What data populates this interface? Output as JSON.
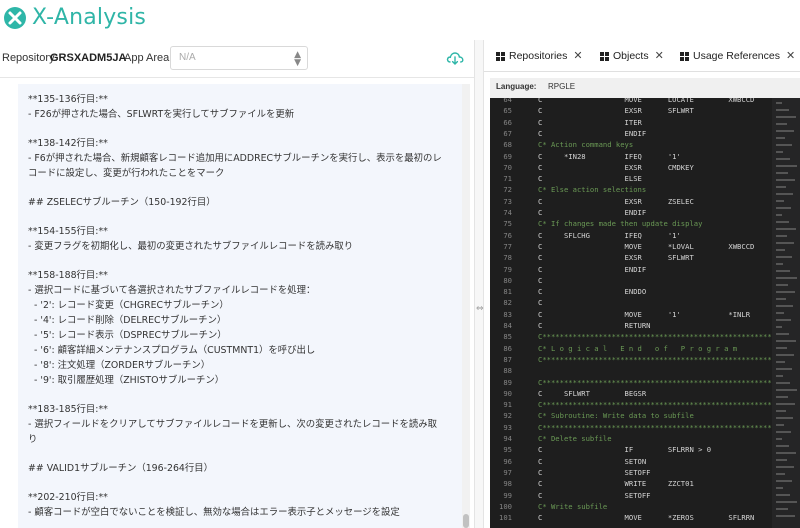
{
  "app": {
    "title": "X-Analysis"
  },
  "repo_bar": {
    "repository_label": "Repository:",
    "repository_value": "GRSXADM5JA",
    "app_area_label": "App Area:",
    "app_area_value": "N/A"
  },
  "doc": {
    "blocks": [
      {
        "type": "p",
        "text": "**135-136行目:**"
      },
      {
        "type": "p",
        "text": "- F26が押された場合、SFLWRTを実行してサブファイルを更新"
      },
      {
        "type": "gap"
      },
      {
        "type": "p",
        "text": "**138-142行目:**"
      },
      {
        "type": "p",
        "text": "- F6が押された場合、新規顧客レコード追加用にADDRECサブルーチンを実行し、表示を最初のレ"
      },
      {
        "type": "p",
        "text": "コードに設定し、変更が行われたことをマーク"
      },
      {
        "type": "gap"
      },
      {
        "type": "p",
        "text": "## ZSELECサブルーチン（150-192行目）"
      },
      {
        "type": "gap"
      },
      {
        "type": "p",
        "text": "**154-155行目:**"
      },
      {
        "type": "p",
        "text": "- 変更フラグを初期化し、最初の変更されたサブファイルレコードを読み取り"
      },
      {
        "type": "gap"
      },
      {
        "type": "p",
        "text": "**158-188行目:**"
      },
      {
        "type": "p",
        "text": "- 選択コードに基づいて各選択されたサブファイルレコードを処理："
      },
      {
        "type": "li",
        "text": "- '2': レコード変更（CHGRECサブルーチン）"
      },
      {
        "type": "li",
        "text": "- '4': レコード削除（DELRECサブルーチン）"
      },
      {
        "type": "li",
        "text": "- '5': レコード表示（DSPRECサブルーチン）"
      },
      {
        "type": "li",
        "text": "- '6': 顧客詳細メンテナンスプログラム（CUSTMNT1）を呼び出し"
      },
      {
        "type": "li",
        "text": "- '8': 注文処理（ZORDERサブルーチン）"
      },
      {
        "type": "li",
        "text": "- '9': 取引履歴処理（ZHISTOサブルーチン）"
      },
      {
        "type": "gap"
      },
      {
        "type": "p",
        "text": "**183-185行目:**"
      },
      {
        "type": "p",
        "text": "- 選択フィールドをクリアしてサブファイルレコードを更新し、次の変更されたレコードを読み取"
      },
      {
        "type": "p",
        "text": "り"
      },
      {
        "type": "gap"
      },
      {
        "type": "p",
        "text": "## VALID1サブルーチン（196-264行目）"
      },
      {
        "type": "gap"
      },
      {
        "type": "p",
        "text": "**202-210行目:**"
      },
      {
        "type": "p",
        "text": "- 顧客コードが空白でないことを検証し、無効な場合はエラー表示子とメッセージを設定"
      }
    ]
  },
  "tabs": [
    {
      "label": "Repositories"
    },
    {
      "label": "Objects"
    },
    {
      "label": "Usage References"
    }
  ],
  "language_bar": {
    "label": "Language:",
    "value": "RPGLE"
  },
  "code_lines": [
    {
      "n": "64",
      "t": "C                   MOVE      LOCATE        XWBCCD",
      "c": 0
    },
    {
      "n": "65",
      "t": "C                   EXSR      SFLWRT",
      "c": 0
    },
    {
      "n": "66",
      "t": "C                   ITER",
      "c": 0
    },
    {
      "n": "67",
      "t": "C                   ENDIF",
      "c": 0
    },
    {
      "n": "68",
      "t": "C* Action command keys",
      "c": 1
    },
    {
      "n": "69",
      "t": "C     *IN28         IFEQ      '1'",
      "c": 0
    },
    {
      "n": "70",
      "t": "C                   EXSR      CMDKEY",
      "c": 0
    },
    {
      "n": "71",
      "t": "C                   ELSE",
      "c": 0
    },
    {
      "n": "72",
      "t": "C* Else action selections",
      "c": 1
    },
    {
      "n": "73",
      "t": "C                   EXSR      ZSELEC",
      "c": 0
    },
    {
      "n": "74",
      "t": "C                   ENDIF",
      "c": 0
    },
    {
      "n": "75",
      "t": "C* If changes made then update display",
      "c": 1
    },
    {
      "n": "76",
      "t": "C     SFLCHG        IFEQ      '1'",
      "c": 0
    },
    {
      "n": "77",
      "t": "C                   MOVE      *LOVAL        XWBCCD",
      "c": 0
    },
    {
      "n": "78",
      "t": "C                   EXSR      SFLWRT",
      "c": 0
    },
    {
      "n": "79",
      "t": "C                   ENDIF",
      "c": 0
    },
    {
      "n": "80",
      "t": "C",
      "c": 0
    },
    {
      "n": "81",
      "t": "C                   ENDDO",
      "c": 0
    },
    {
      "n": "82",
      "t": "C",
      "c": 0
    },
    {
      "n": "83",
      "t": "C                   MOVE      '1'           *INLR",
      "c": 0
    },
    {
      "n": "84",
      "t": "C                   RETURN",
      "c": 0
    },
    {
      "n": "85",
      "t": "C*************************************************************",
      "c": 1
    },
    {
      "n": "86",
      "t": "C* L o g i c a l   E n d   o f   P r o g r a m",
      "c": 1
    },
    {
      "n": "87",
      "t": "C*************************************************************",
      "c": 1
    },
    {
      "n": "88",
      "t": "",
      "c": 0
    },
    {
      "n": "89",
      "t": "C*************************************************************",
      "c": 1
    },
    {
      "n": "90",
      "t": "C     SFLWRT        BEGSR",
      "c": 0
    },
    {
      "n": "91",
      "t": "C*************************************************************",
      "c": 1
    },
    {
      "n": "92",
      "t": "C* Subroutine: Write data to subfile",
      "c": 1
    },
    {
      "n": "93",
      "t": "C*************************************************************",
      "c": 1
    },
    {
      "n": "94",
      "t": "C* Delete subfile",
      "c": 1
    },
    {
      "n": "95",
      "t": "C                   IF        SFLRRN > 0",
      "c": 0
    },
    {
      "n": "96",
      "t": "C                   SETON",
      "c": 0
    },
    {
      "n": "97",
      "t": "C                   SETOFF",
      "c": 0
    },
    {
      "n": "98",
      "t": "C                   WRITE     ZZCT01",
      "c": 0
    },
    {
      "n": "99",
      "t": "C                   SETOFF",
      "c": 0
    },
    {
      "n": "100",
      "t": "C* Write subfile",
      "c": 1
    },
    {
      "n": "101",
      "t": "C                   MOVE      *ZEROS        SFLRRN",
      "c": 0
    }
  ]
}
